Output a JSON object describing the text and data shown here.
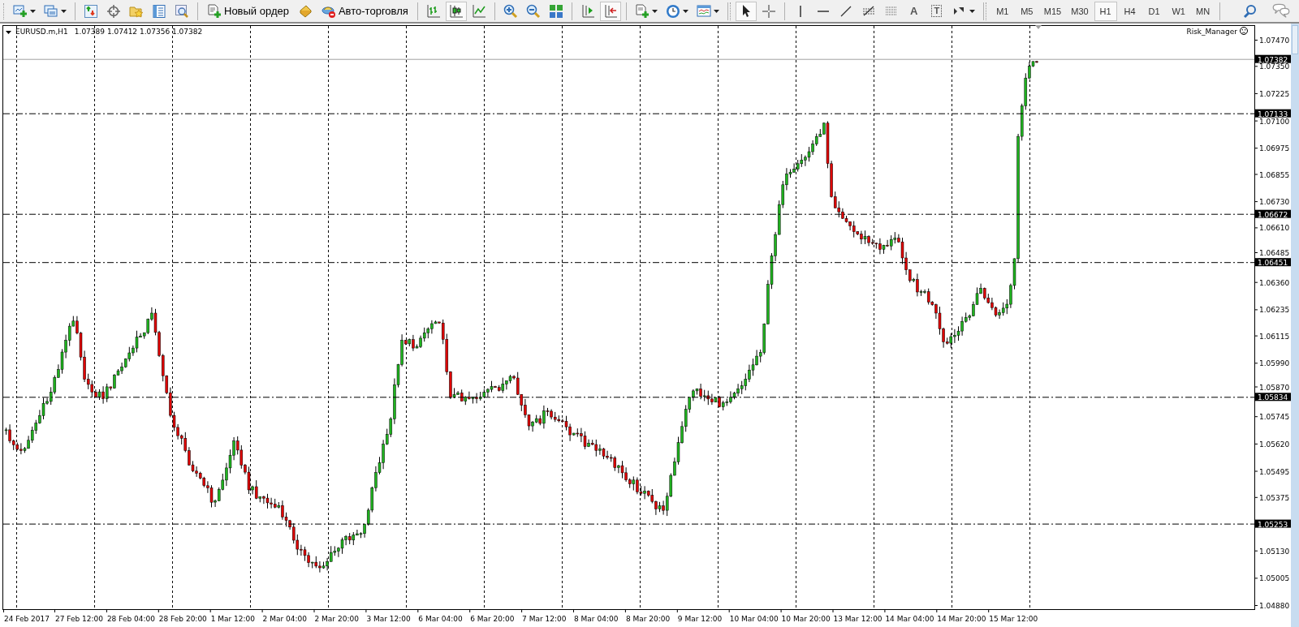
{
  "toolbar": {
    "groups": [
      [
        {
          "kind": "icon",
          "selected": false,
          "dropdown": true
        },
        {
          "kind": "icon",
          "selected": false,
          "dropdown": true
        }
      ],
      [
        {
          "kind": "icon",
          "selected": false
        },
        {
          "kind": "icon",
          "selected": false
        },
        {
          "kind": "icon",
          "selected": false
        },
        {
          "kind": "icon",
          "selected": false
        },
        {
          "kind": "icon",
          "selected": false
        }
      ],
      [
        {
          "kind": "button",
          "label": "Новый ордер"
        },
        {
          "kind": "icon",
          "selected": false
        },
        {
          "kind": "button",
          "label": "Авто-торговля"
        }
      ],
      [
        {
          "kind": "icon",
          "selected": false
        },
        {
          "kind": "icon",
          "selected": true
        },
        {
          "kind": "icon",
          "selected": false
        }
      ],
      [
        {
          "kind": "icon",
          "selected": false
        },
        {
          "kind": "icon",
          "selected": false
        },
        {
          "kind": "icon",
          "selected": false
        }
      ],
      [
        {
          "kind": "icon",
          "selected": false
        },
        {
          "kind": "icon",
          "selected": true
        }
      ],
      [
        {
          "kind": "icon",
          "selected": false,
          "dropdown": true
        },
        {
          "kind": "icon",
          "selected": false,
          "dropdown": true
        },
        {
          "kind": "icon",
          "selected": false,
          "dropdown": true
        }
      ],
      [
        {
          "kind": "icon",
          "selected": true
        },
        {
          "kind": "icon",
          "selected": false
        }
      ],
      [
        {
          "kind": "icon",
          "selected": false
        },
        {
          "kind": "icon",
          "selected": false
        },
        {
          "kind": "icon",
          "selected": false
        },
        {
          "kind": "icon",
          "selected": false
        },
        {
          "kind": "icon",
          "selected": false
        },
        {
          "kind": "glyph",
          "label": "A"
        },
        {
          "kind": "boxed-glyph",
          "label": "T"
        },
        {
          "kind": "icon",
          "selected": false,
          "dropdown": true
        }
      ]
    ]
  },
  "timeframes": [
    {
      "label": "M1",
      "selected": false
    },
    {
      "label": "M5",
      "selected": false
    },
    {
      "label": "M15",
      "selected": false
    },
    {
      "label": "M30",
      "selected": false
    },
    {
      "label": "H1",
      "selected": true
    },
    {
      "label": "H4",
      "selected": false
    },
    {
      "label": "D1",
      "selected": false
    },
    {
      "label": "W1",
      "selected": false
    },
    {
      "label": "MN",
      "selected": false
    }
  ],
  "chart": {
    "symbol": "EURUSD.m,H1",
    "quote": "1.07389 1.07412 1.07356 1.07382",
    "expert": "Risk_Manager",
    "price_axis": [
      "1.07470",
      "1.07350",
      "1.07225",
      "1.07100",
      "1.06975",
      "1.06855",
      "1.06730",
      "1.06610",
      "1.06485",
      "1.06360",
      "1.06235",
      "1.06115",
      "1.05990",
      "1.05870",
      "1.05745",
      "1.05620",
      "1.05495",
      "1.05375",
      "1.05130",
      "1.05005",
      "1.04880"
    ],
    "levels": [
      {
        "label": "1.07382",
        "kind": "current"
      },
      {
        "label": "1.07133",
        "kind": "level"
      },
      {
        "label": "1.06672",
        "kind": "level"
      },
      {
        "label": "1.06451",
        "kind": "level"
      },
      {
        "label": "1.05834",
        "kind": "level"
      },
      {
        "label": "1.05253",
        "kind": "level"
      }
    ],
    "time_axis": [
      "24 Feb 2017",
      "27 Feb 12:00",
      "28 Feb 04:00",
      "28 Feb 20:00",
      "1 Mar 12:00",
      "2 Mar 04:00",
      "2 Mar 20:00",
      "3 Mar 12:00",
      "6 Mar 04:00",
      "6 Mar 20:00",
      "7 Mar 12:00",
      "8 Mar 04:00",
      "8 Mar 20:00",
      "9 Mar 12:00",
      "10 Mar 04:00",
      "10 Mar 20:00",
      "13 Mar 12:00",
      "14 Mar 04:00",
      "14 Mar 20:00",
      "15 Mar 12:00"
    ]
  }
}
